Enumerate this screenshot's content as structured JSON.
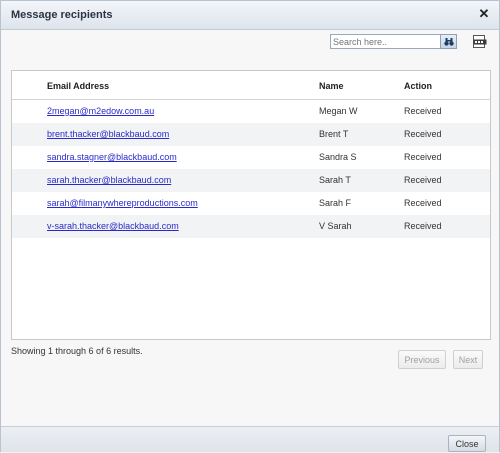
{
  "dialog": {
    "title": "Message recipients",
    "close_icon": "close-icon"
  },
  "search": {
    "placeholder": "Search here..",
    "value": "",
    "button_icon": "binoculars-icon",
    "export_icon": "export-icon"
  },
  "table": {
    "headers": {
      "email": "Email Address",
      "name": "Name",
      "action": "Action"
    },
    "rows": [
      {
        "email": "2megan@m2edow.com.au",
        "name": "Megan W",
        "action": "Received"
      },
      {
        "email": "brent.thacker@blackbaud.com",
        "name": "Brent T",
        "action": "Received"
      },
      {
        "email": "sandra.stagner@blackbaud.com",
        "name": "Sandra S",
        "action": "Received"
      },
      {
        "email": "sarah.thacker@blackbaud.com",
        "name": "Sarah T",
        "action": "Received"
      },
      {
        "email": "sarah@filmanywhereproductions.com",
        "name": "Sarah F",
        "action": "Received"
      },
      {
        "email": "v-sarah.thacker@blackbaud.com",
        "name": "V Sarah",
        "action": "Received"
      }
    ]
  },
  "pagination": {
    "summary": "Showing 1 through 6 of 6 results.",
    "previous_label": "Previous",
    "next_label": "Next"
  },
  "footer": {
    "close_label": "Close"
  }
}
